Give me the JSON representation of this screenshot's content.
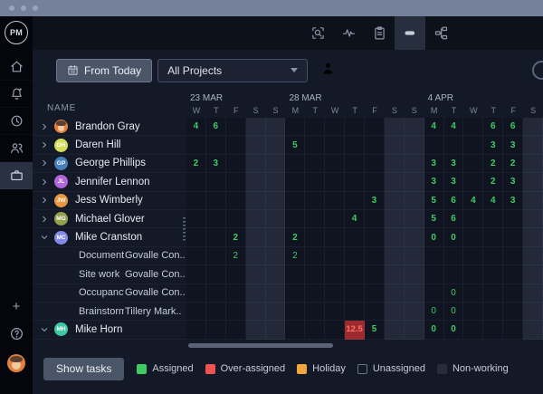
{
  "titlebar": {
    "dots": [
      "dot",
      "dot",
      "dot"
    ]
  },
  "sidebar": {
    "logo_text": "PM",
    "nav_items": [
      {
        "name": "home",
        "selected": false
      },
      {
        "name": "notifications",
        "selected": false
      },
      {
        "name": "recent",
        "selected": false
      },
      {
        "name": "team",
        "selected": false
      },
      {
        "name": "workload",
        "selected": true
      }
    ],
    "bottom_items": [
      {
        "name": "add",
        "glyph": "+"
      },
      {
        "name": "help",
        "glyph": "?"
      },
      {
        "name": "user-avatar",
        "color": "#e0813f"
      }
    ]
  },
  "header": {
    "view_icons": [
      {
        "name": "zoom-search",
        "selected": false
      },
      {
        "name": "activity",
        "selected": false
      },
      {
        "name": "clipboard",
        "selected": false
      },
      {
        "name": "workload-bar",
        "selected": true
      },
      {
        "name": "sitemap",
        "selected": false
      }
    ]
  },
  "toolbar": {
    "from_today_label": "From Today",
    "projects_filter_value": "All Projects"
  },
  "workload_grid": {
    "name_header": "NAME",
    "date_labels": [
      {
        "text": "23 MAR",
        "col": 0
      },
      {
        "text": "28 MAR",
        "col": 5
      },
      {
        "text": "4 APR",
        "col": 12
      }
    ],
    "day_letters": [
      "W",
      "T",
      "F",
      "S",
      "S",
      "M",
      "T",
      "W",
      "T",
      "F",
      "S",
      "S",
      "M",
      "T",
      "W",
      "T",
      "F",
      "S"
    ],
    "weekend_cols": [
      3,
      4,
      10,
      11,
      17
    ],
    "rows": [
      {
        "type": "person",
        "name": "Brandon Gray",
        "expanded": false,
        "avatar": {
          "face": true,
          "color": "#e0813f"
        },
        "cells": [
          [
            0,
            "4"
          ],
          [
            1,
            "6"
          ],
          [
            12,
            "4"
          ],
          [
            13,
            "4"
          ],
          [
            15,
            "6"
          ],
          [
            16,
            "6"
          ]
        ]
      },
      {
        "type": "person",
        "name": "Daren Hill",
        "expanded": false,
        "avatar": {
          "initials": "DH",
          "color": "#d3dd5a"
        },
        "cells": [
          [
            5,
            "5"
          ],
          [
            15,
            "3"
          ],
          [
            16,
            "3"
          ]
        ]
      },
      {
        "type": "person",
        "name": "George Phillips",
        "expanded": false,
        "avatar": {
          "initials": "GP",
          "color": "#4580bb"
        },
        "cells": [
          [
            0,
            "2"
          ],
          [
            1,
            "3"
          ],
          [
            12,
            "3"
          ],
          [
            13,
            "3"
          ],
          [
            15,
            "2"
          ],
          [
            16,
            "2"
          ]
        ]
      },
      {
        "type": "person",
        "name": "Jennifer Lennon",
        "expanded": false,
        "avatar": {
          "initials": "JL",
          "color": "#b266db"
        },
        "cells": [
          [
            12,
            "3"
          ],
          [
            13,
            "3"
          ],
          [
            15,
            "2"
          ],
          [
            16,
            "3"
          ]
        ]
      },
      {
        "type": "person",
        "name": "Jess Wimberly",
        "expanded": false,
        "avatar": {
          "initials": "JW",
          "color": "#ec9540"
        },
        "cells": [
          [
            9,
            "3"
          ],
          [
            12,
            "5"
          ],
          [
            13,
            "6"
          ],
          [
            14,
            "4"
          ],
          [
            15,
            "4"
          ],
          [
            16,
            "3"
          ]
        ]
      },
      {
        "type": "person",
        "name": "Michael Glover",
        "expanded": false,
        "avatar": {
          "initials": "MG",
          "color": "#93a04c"
        },
        "cells": [
          [
            8,
            "4"
          ],
          [
            12,
            "5"
          ],
          [
            13,
            "6"
          ]
        ]
      },
      {
        "type": "person",
        "name": "Mike Cranston",
        "expanded": true,
        "avatar": {
          "initials": "MC",
          "color": "#8589e6"
        },
        "cells": [
          [
            2,
            "2"
          ],
          [
            5,
            "2"
          ],
          [
            12,
            "0"
          ],
          [
            13,
            "0"
          ]
        ]
      },
      {
        "type": "task",
        "task": "Documents ...",
        "project": "Govalle Con..",
        "cells": [
          [
            2,
            "2"
          ],
          [
            5,
            "2"
          ]
        ]
      },
      {
        "type": "task",
        "task": "Site work",
        "project": "Govalle Con..",
        "cells": []
      },
      {
        "type": "task",
        "task": "Occupancy",
        "project": "Govalle Con..",
        "cells": [
          [
            13,
            "0"
          ]
        ]
      },
      {
        "type": "task",
        "task": "Brainstorm I...",
        "project": "Tillery Mark..",
        "cells": [
          [
            12,
            "0"
          ],
          [
            13,
            "0"
          ]
        ]
      },
      {
        "type": "person",
        "name": "Mike Horn",
        "expanded": true,
        "avatar": {
          "initials": "MH",
          "color": "#3fc7a4"
        },
        "cells": [
          [
            8,
            "12.5",
            "over"
          ],
          [
            9,
            "5"
          ],
          [
            12,
            "0"
          ],
          [
            13,
            "0"
          ]
        ]
      }
    ]
  },
  "footer": {
    "show_tasks_label": "Show tasks",
    "legend": [
      {
        "label": "Assigned",
        "color": "#3ecb63",
        "style": "filled"
      },
      {
        "label": "Over-assigned",
        "color": "#ef5350",
        "style": "filled"
      },
      {
        "label": "Holiday",
        "color": "#f2a63b",
        "style": "filled"
      },
      {
        "label": "Unassigned",
        "color": "#6a7389",
        "style": "outline"
      },
      {
        "label": "Non-working",
        "color": "#272d3d",
        "style": "filled"
      }
    ]
  },
  "colors": {
    "assigned_text": "#3ecb63",
    "over_cell_bg": "#9e2a30",
    "over_cell_text": "#ff7068"
  }
}
